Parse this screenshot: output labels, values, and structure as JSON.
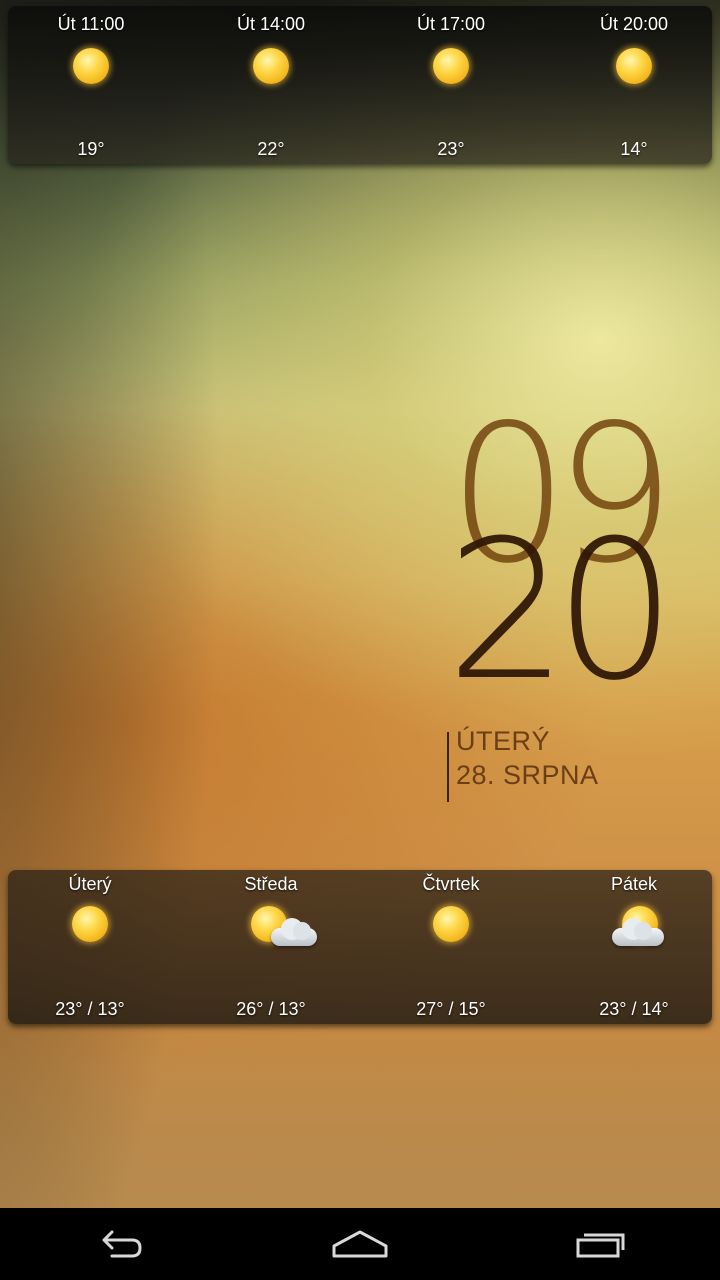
{
  "hourly_forecast": [
    {
      "time": "Út 11:00",
      "icon": "sun-icon",
      "temp": "19°"
    },
    {
      "time": "Út 14:00",
      "icon": "sun-icon",
      "temp": "22°"
    },
    {
      "time": "Út 17:00",
      "icon": "sun-icon",
      "temp": "23°"
    },
    {
      "time": "Út 20:00",
      "icon": "sun-icon",
      "temp": "14°"
    }
  ],
  "clock": {
    "hours": "09",
    "minutes": "20",
    "day": "ÚTERÝ",
    "date": "28. SRPNA"
  },
  "daily_forecast": [
    {
      "day": "Úterý",
      "icon": "sun-icon",
      "temps": "23° / 13°"
    },
    {
      "day": "Středa",
      "icon": "partly-cloudy-icon",
      "temps": "26° / 13°"
    },
    {
      "day": "Čtvrtek",
      "icon": "sun-icon",
      "temps": "27° / 15°"
    },
    {
      "day": "Pátek",
      "icon": "mostly-cloudy-icon",
      "temps": "23° / 14°"
    }
  ],
  "navbar": {
    "back": "back-icon",
    "home": "home-icon",
    "recents": "recent-apps-icon"
  },
  "colors": {
    "clock_hours": "#6e3e0a",
    "clock_minutes": "#301806",
    "date_text": "#6b3e14",
    "navbar_bg": "#000000"
  }
}
